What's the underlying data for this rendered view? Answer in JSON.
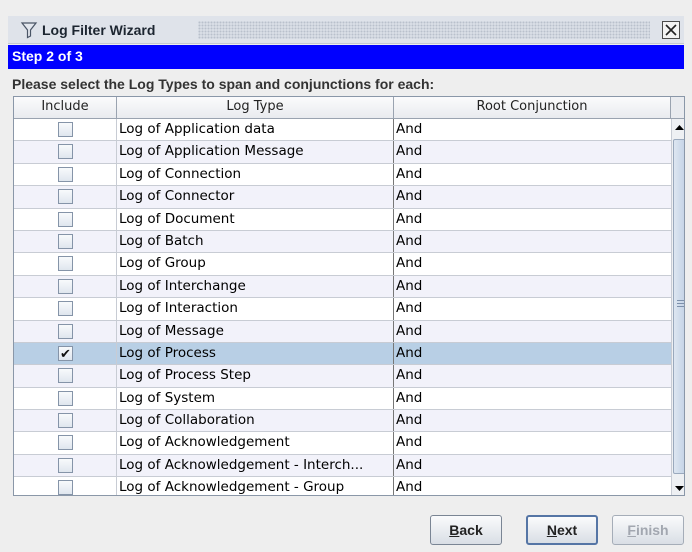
{
  "window": {
    "title": "Log Filter Wizard",
    "step": "Step 2 of 3",
    "instruction": "Please select the Log Types to span and conjunctions for each:"
  },
  "table": {
    "columns": [
      "Include",
      "Log Type",
      "Root Conjunction"
    ],
    "rows": [
      {
        "include": false,
        "log_type": "Log of Application data",
        "conjunction": "And"
      },
      {
        "include": false,
        "log_type": "Log of Application Message",
        "conjunction": "And"
      },
      {
        "include": false,
        "log_type": "Log of Connection",
        "conjunction": "And"
      },
      {
        "include": false,
        "log_type": "Log of Connector",
        "conjunction": "And"
      },
      {
        "include": false,
        "log_type": "Log of Document",
        "conjunction": "And"
      },
      {
        "include": false,
        "log_type": "Log of Batch",
        "conjunction": "And"
      },
      {
        "include": false,
        "log_type": "Log of Group",
        "conjunction": "And"
      },
      {
        "include": false,
        "log_type": "Log of Interchange",
        "conjunction": "And"
      },
      {
        "include": false,
        "log_type": "Log of Interaction",
        "conjunction": "And"
      },
      {
        "include": false,
        "log_type": "Log of Message",
        "conjunction": "And"
      },
      {
        "include": true,
        "log_type": "Log of Process",
        "conjunction": "And",
        "selected": true
      },
      {
        "include": false,
        "log_type": "Log of Process Step",
        "conjunction": "And"
      },
      {
        "include": false,
        "log_type": "Log of System",
        "conjunction": "And"
      },
      {
        "include": false,
        "log_type": "Log of Collaboration",
        "conjunction": "And"
      },
      {
        "include": false,
        "log_type": "Log of Acknowledgement",
        "conjunction": "And"
      },
      {
        "include": false,
        "log_type": "Log of Acknowledgement - Interch...",
        "conjunction": "And"
      },
      {
        "include": false,
        "log_type": "Log of Acknowledgement - Group",
        "conjunction": "And"
      }
    ]
  },
  "buttons": {
    "back": {
      "label_accel": "B",
      "label_rest": "ack"
    },
    "next": {
      "label_accel": "N",
      "label_rest": "ext"
    },
    "finish": {
      "label_accel": "F",
      "label_rest": "inish"
    }
  },
  "colors": {
    "banner": "#0000ff",
    "selected_row": "#b8cfe5",
    "alt_row": "#f2f2fa"
  },
  "icons": {
    "title": "filter-funnel-icon",
    "close": "close-icon"
  }
}
